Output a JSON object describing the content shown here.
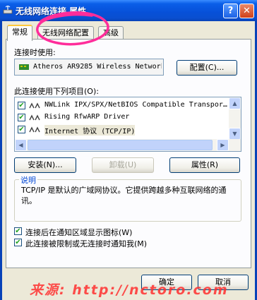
{
  "window": {
    "title": "无线网络连接 属性",
    "help_btn": "?",
    "close_btn": "✕"
  },
  "tabs": [
    {
      "label": "常规",
      "active": true
    },
    {
      "label": "无线网络配置",
      "active": false
    },
    {
      "label": "高级",
      "active": false
    }
  ],
  "connect_using": {
    "label": "连接时使用:",
    "adapter": "Atheros AR9285 Wireless Network",
    "configure_button": "配置(C)..."
  },
  "items_section": {
    "label": "此连接使用下列项目(O):",
    "items": [
      {
        "text": "NWLink IPX/SPX/NetBIOS Compatible Transpor…",
        "checked": true
      },
      {
        "text": "Rising RfwARP Driver",
        "checked": true
      },
      {
        "text": "Internet 协议 (TCP/IP)",
        "checked": true
      }
    ]
  },
  "actions": {
    "install": "安装(N)...",
    "uninstall": "卸载(U)",
    "properties": "属性(R)"
  },
  "description": {
    "title": "说明",
    "text": "TCP/IP 是默认的广域网协议。它提供跨越多种互联网络的通讯。"
  },
  "options": [
    {
      "label": "连接后在通知区域显示图标(W)",
      "checked": true
    },
    {
      "label": "此连接被限制或无连接时通知我(M)",
      "checked": true
    }
  ],
  "footer": {
    "ok": "确定",
    "cancel": "取消"
  },
  "watermark": "来源: http://nctoro.com",
  "colors": {
    "titlebar": "#0a5ee8",
    "dialog_bg": "#ece9d8",
    "annotation": "#ff2d9a",
    "watermark": "#ff3030"
  }
}
